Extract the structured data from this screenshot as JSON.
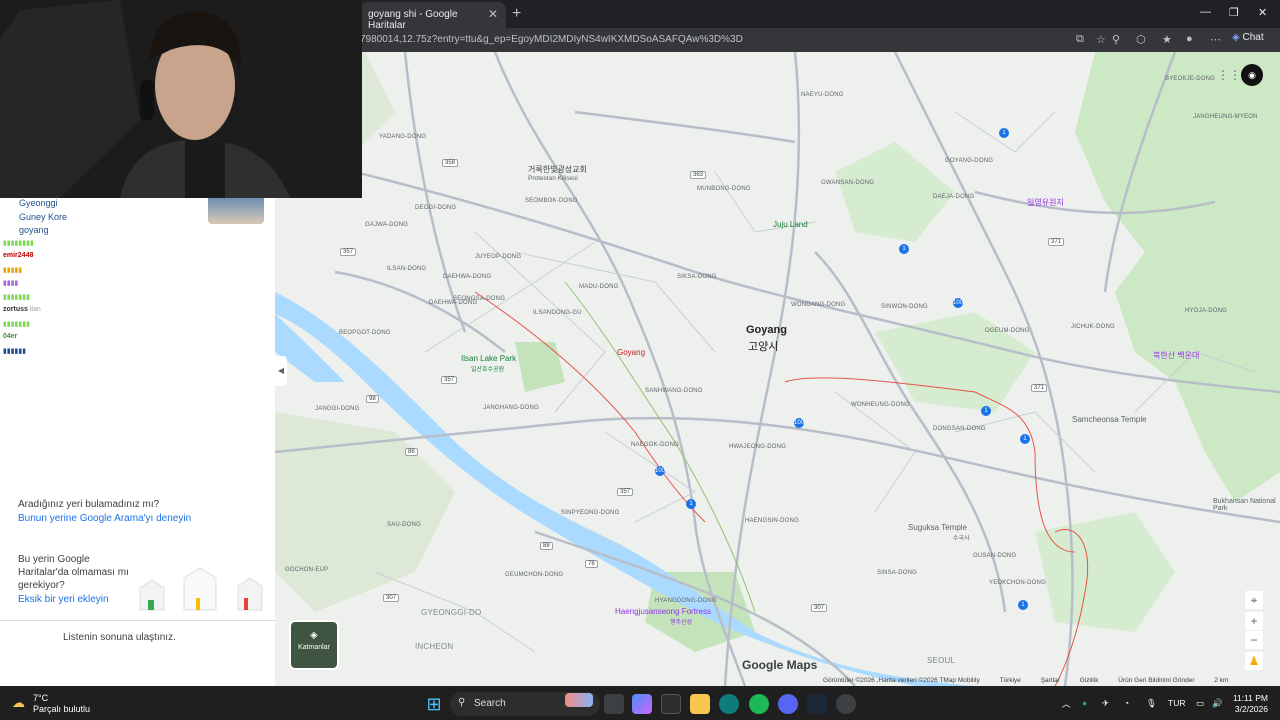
{
  "browser": {
    "tab_title": "goyang shi - Google Haritalar",
    "url": "7980014,12.75z?entry=ttu&g_ep=EgoyMDI2MDIyNS4wIKXMDSoASAFQAw%3D%3D",
    "chat_label": "Chat"
  },
  "chat": {
    "lines": [
      {
        "user": "Gyeonggi",
        "text": ""
      },
      {
        "user": "Guney Kore",
        "text": ""
      },
      {
        "user": "goyang",
        "text": ""
      },
      {
        "user": "emir2448",
        "text": ""
      },
      {
        "user": "zortuss",
        "text": "ilan"
      },
      {
        "user": "04er",
        "text": ""
      }
    ]
  },
  "panel": {
    "notfound_q": "Aradığınız yeri bulamadınız mı?",
    "notfound_link": "Bunun yerine Google Arama'yı deneyin",
    "missing_q_1": "Bu yerin Google",
    "missing_q_2": "Haritalar'da olmaması mı",
    "missing_q_3": "gerekiyor?",
    "missing_link": "Eksik bir yeri ekleyin",
    "end": "Listenin sonuna ulaştınız."
  },
  "map": {
    "main_city": "Goyang",
    "main_city_ko": "고양시",
    "pin_label": "Goyang",
    "layers_label": "Katmanlar",
    "logo": "Google Maps",
    "attribution": [
      "Görüntüler ©2026 ,Harita verileri ©2026 TMap Mobility",
      "Türkiye",
      "Şartlar",
      "Gizlilik",
      "Ürün Geri Bildirimi Gönder",
      "2 km"
    ],
    "pois": [
      {
        "name": "Ilsan Lake Park",
        "ko": "일산호수공원",
        "color": "#188038"
      },
      {
        "name": "Juju Land",
        "color": "#188038"
      },
      {
        "name": "Protestan Kilisesi",
        "ko": "거룩한빛광성교회",
        "color": "#5f6368"
      },
      {
        "name": "Haengjusanseong Fortress",
        "ko": "행주산성",
        "color": "#9334e6"
      },
      {
        "name": "Samcheonsa Temple",
        "color": "#5f6368"
      },
      {
        "name": "Suguksa Temple",
        "ko": "수국사",
        "color": "#5f6368"
      },
      {
        "name": "Bukhansan National Park",
        "color": "#5f6368"
      },
      {
        "name": "북한산 백운대",
        "color": "#9334e6"
      },
      {
        "name": "일영유원지",
        "color": "#9334e6"
      }
    ],
    "areas": [
      "BYEOKJE-DONG",
      "JANGHEUNG-MYEON",
      "NAEYU-DONG",
      "YADANG-DONG",
      "MUNBONG-DONG",
      "GWANSAN-DONG",
      "DAEJA-DONG",
      "GOYANG-DONG",
      "DEOGI-DONG",
      "GAJWA-DONG",
      "SEOMBOK-DONG",
      "DAEHWA-DONG",
      "ILSAN-DONG",
      "JANGHANG-DONG",
      "ILSANDONG-GU",
      "SIKSA-DONG",
      "BEOPGOT-DONG",
      "JUYEOP-DONG",
      "MADU-DONG",
      "SANHWANG-DONG",
      "WONDANG-DONG",
      "SINWON-DONG",
      "OGEUM-DONG",
      "JICHUK-DONG",
      "HYOJA-DONG",
      "SEONGSA-DONG",
      "WONHEUNG-DONG",
      "DONGSAN-DONG",
      "SINPYEONG-DONG",
      "HAENGSIN-DONG",
      "HWAJEONG-DONG",
      "GUSAN-DONG",
      "YEOKCHON-DONG",
      "SINSA-DONG",
      "GEUMCHON-DONG",
      "JANGGI-DONG",
      "GOCHON-EUP",
      "SAU-DONG",
      "GYEONGGI-DO",
      "INCHEON",
      "SEOUL",
      "DAEHWA-DONG",
      "NAEGOK-DONG",
      "HYANGDONG-DONG"
    ]
  },
  "taskbar": {
    "temp": "7°C",
    "weather": "Parçalı bulutlu",
    "search": "Search",
    "lang": "TUR",
    "time": "11:11 PM",
    "date": "3/2/2026"
  }
}
